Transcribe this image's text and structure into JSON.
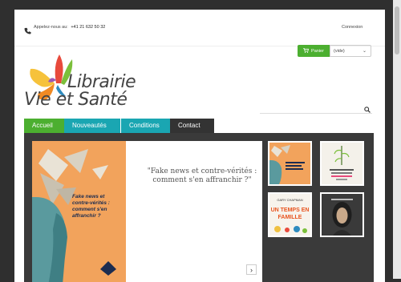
{
  "topbar": {
    "call_label": "Appelez-nous au:",
    "phone": "+41 21 632 50 32",
    "login": "Connexion"
  },
  "logo": {
    "line1": "Librairie",
    "line2": "Vie et Santé"
  },
  "cart": {
    "label": "Panier",
    "status": "(vide)"
  },
  "nav": {
    "tabs": [
      {
        "label": "Accueil"
      },
      {
        "label": "Nouveautés"
      },
      {
        "label": "Conditions"
      },
      {
        "label": "Contact"
      }
    ]
  },
  "slider": {
    "cover_title": "Fake news et contre-vérités : comment s'en affranchir ?",
    "quote": "\"Fake news et contre-vérités : comment s'en affranchir ?\""
  },
  "thumbs": [
    {
      "name": "book-fake-news"
    },
    {
      "name": "book-randonnees"
    },
    {
      "name": "book-un-temps-en-famille",
      "title": "UN TEMPS EN FAMILLE",
      "author": "GARY CHAPMAN"
    },
    {
      "name": "book-portrait-woman"
    }
  ],
  "colors": {
    "accent_green": "#4caf30",
    "accent_teal": "#1aa6b2",
    "dark": "#333333"
  }
}
